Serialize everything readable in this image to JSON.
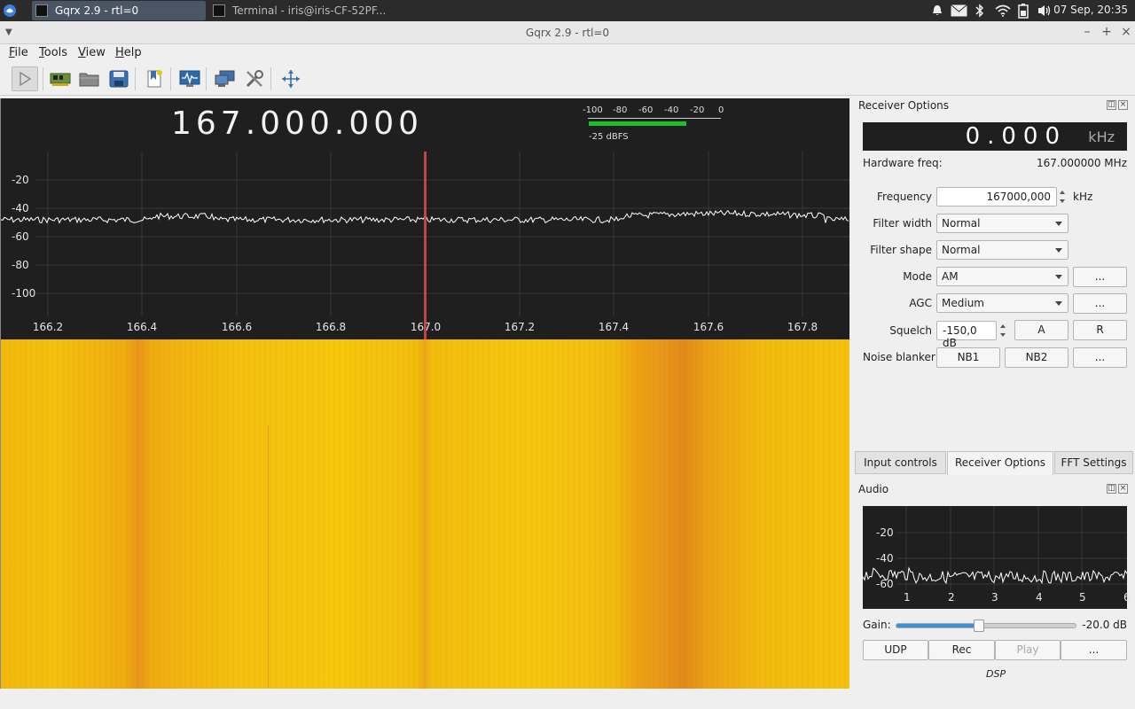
{
  "taskbar": {
    "tasks": [
      "Gqrx 2.9 - rtl=0",
      "Terminal - iris@iris-CF-52PF..."
    ],
    "clock": "07 Sep, 20:35"
  },
  "window": {
    "title": "Gqrx 2.9 - rtl=0"
  },
  "menubar": {
    "items": [
      {
        "accel": "F",
        "rest": "ile"
      },
      {
        "accel": "T",
        "rest": "ools"
      },
      {
        "accel": "V",
        "rest": "iew"
      },
      {
        "accel": "H",
        "rest": "elp"
      }
    ]
  },
  "spectrum": {
    "frequency_display": "167.000.000",
    "meter": {
      "ticks": [
        "-100",
        "-80",
        "-60",
        "-40",
        "-20",
        "0"
      ],
      "label": "-25 dBFS",
      "level_fraction": 0.73
    },
    "y_ticks": [
      "-20",
      "-40",
      "-60",
      "-80",
      "-100"
    ],
    "x_ticks": [
      "166.2",
      "166.4",
      "166.6",
      "166.8",
      "167.0",
      "167.2",
      "167.4",
      "167.6",
      "167.8"
    ],
    "colors": {
      "background": "#1f1f1f",
      "trace": "#ffffff",
      "cursor": "#d94c4c",
      "waterfall_base": "#f4c20e",
      "waterfall_hot": "#e38a1c"
    }
  },
  "receiver": {
    "dock_title": "Receiver Options",
    "offset_value": "0.000",
    "offset_unit": "kHz",
    "hw_label": "Hardware freq:",
    "hw_value": "167.000000 MHz",
    "frequency_label": "Frequency",
    "frequency_value": "167000,000",
    "frequency_unit": "kHz",
    "filter_width_label": "Filter width",
    "filter_width_value": "Normal",
    "filter_shape_label": "Filter shape",
    "filter_shape_value": "Normal",
    "mode_label": "Mode",
    "mode_value": "AM",
    "agc_label": "AGC",
    "agc_value": "Medium",
    "squelch_label": "Squelch",
    "squelch_value": "-150,0 dB",
    "noise_label": "Noise blanker",
    "more": "...",
    "btn_a": "A",
    "btn_r": "R",
    "nb1": "NB1",
    "nb2": "NB2"
  },
  "tabs": [
    "Input controls",
    "Receiver Options",
    "FFT Settings"
  ],
  "audio": {
    "dock_title": "Audio",
    "y_ticks": [
      "-20",
      "-40",
      "-60"
    ],
    "x_ticks": [
      "1",
      "2",
      "3",
      "4",
      "5",
      "6"
    ],
    "gain_label": "Gain:",
    "gain_value": "-20.0 dB",
    "gain_fraction": 0.46,
    "udp": "UDP",
    "rec": "Rec",
    "play": "Play",
    "more": "...",
    "dsp": "DSP"
  }
}
